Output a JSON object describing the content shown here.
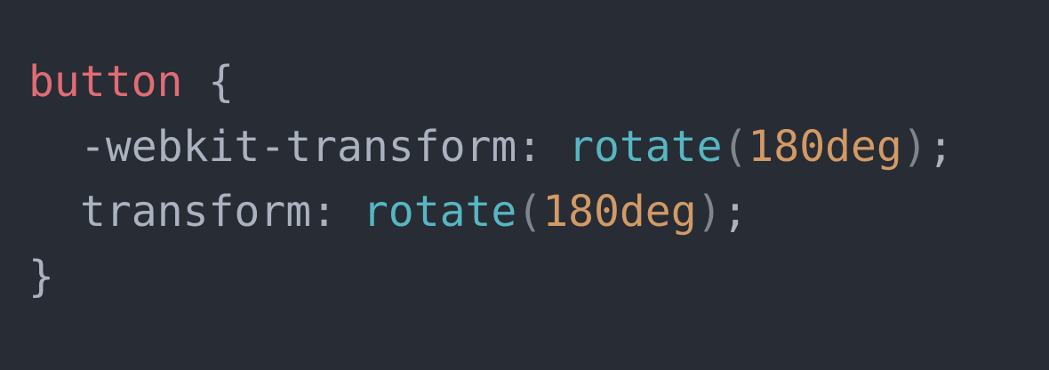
{
  "code": {
    "selector": "button",
    "open_brace": "{",
    "close_brace": "}",
    "declarations": [
      {
        "property": "-webkit-transform",
        "colon": ":",
        "function": "rotate",
        "open_paren": "(",
        "argument": "180deg",
        "close_paren": ")",
        "semicolon": ";"
      },
      {
        "property": "transform",
        "colon": ":",
        "function": "rotate",
        "open_paren": "(",
        "argument": "180deg",
        "close_paren": ")",
        "semicolon": ";"
      }
    ]
  },
  "theme": {
    "background": "#282c34",
    "selector_color": "#e06c75",
    "property_color": "#abb2bf",
    "function_color": "#56b6c2",
    "number_color": "#d19a66",
    "paren_color": "#7f848e"
  }
}
